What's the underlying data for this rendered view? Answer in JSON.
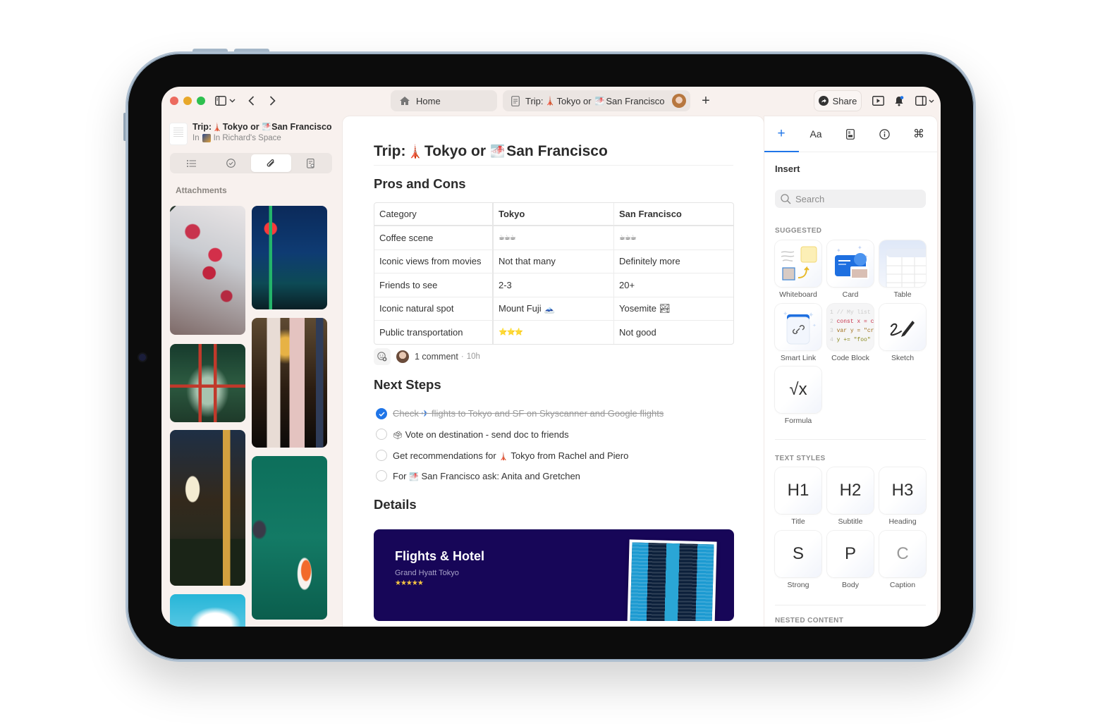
{
  "toolbar": {
    "sidebar_toggle_icon": "sidebar-icon",
    "back_icon": "chevron-left-icon",
    "forward_icon": "chevron-right-icon",
    "tabs": [
      {
        "label": "Home",
        "icon": "house-icon"
      },
      {
        "label_prefix": "Trip:",
        "label_mid": "Tokyo or",
        "label_end": "San Francisco",
        "icon": "document-icon"
      }
    ],
    "new_tab_label": "+",
    "share_label": "Share",
    "accent_color": "#1f75e8"
  },
  "sidebar": {
    "doc_title_prefix": "Trip:",
    "doc_title_mid": "Tokyo or",
    "doc_title_end": "San Francisco",
    "doc_sub_prefix": "In",
    "doc_sub_space": "In Richard's Space",
    "segments": [
      "outline",
      "tasks",
      "attachments",
      "search-document"
    ],
    "active_segment": "attachments",
    "attachments_label": "Attachments",
    "photos": [
      "Plum blossoms",
      "Marugen 24 neon street",
      "Torii gate forest path",
      "Wind chimes",
      "Izakaya at night",
      "Koi pond",
      "Blue sky"
    ]
  },
  "document": {
    "title_prefix": "Trip:",
    "title_mid": "Tokyo or",
    "title_end": "San Francisco",
    "pros_cons_heading": "Pros and Cons",
    "table": {
      "headers": [
        "Category",
        "Tokyo",
        "San Francisco"
      ],
      "rows": [
        [
          "Coffee scene",
          "☕☕☕",
          "☕☕☕"
        ],
        [
          "Iconic views from movies",
          "Not that many",
          "Definitely more"
        ],
        [
          "Friends to see",
          "2-3",
          "20+"
        ],
        [
          "Iconic natural spot",
          "Mount Fuji 🗻",
          "Yosemite 🏞"
        ],
        [
          "Public transportation",
          "⭐⭐⭐",
          "Not good"
        ]
      ]
    },
    "comments": {
      "count_label": "1 comment",
      "separator": "·",
      "time": "10h"
    },
    "next_steps_heading": "Next Steps",
    "todos": [
      {
        "emoji": "",
        "text_a": "Check",
        "emoji_mid": "✈",
        "text_b": "flights to Tokyo and SF on Skyscanner and Google flights",
        "done": true
      },
      {
        "emoji": "🗳",
        "text_a": "Vote on destination - send doc to friends",
        "emoji_mid": "",
        "text_b": "",
        "done": false
      },
      {
        "emoji": "",
        "text_a": "Get recommendations for",
        "emoji_mid": "🗼",
        "text_b": "Tokyo from Rachel and Piero",
        "done": false
      },
      {
        "emoji": "",
        "text_a": "For",
        "emoji_mid": "🌁",
        "text_b": "San Francisco ask: Anita and Gretchen",
        "done": false
      }
    ],
    "details_heading": "Details",
    "card": {
      "title": "Flights & Hotel",
      "subtitle": "Grand Hyatt Tokyo",
      "stars": "★★★★★",
      "rating": 5,
      "bg_color": "#170658"
    }
  },
  "right_panel": {
    "tabs": [
      {
        "label": "+",
        "name": "insert"
      },
      {
        "label": "Aa",
        "name": "format"
      },
      {
        "label": "▤",
        "name": "document-info"
      },
      {
        "label": "ⓘ",
        "name": "info"
      },
      {
        "label": "⌘",
        "name": "shortcuts"
      }
    ],
    "active_tab": "insert",
    "insert_label": "Insert",
    "search_placeholder": "Search",
    "suggested_label": "SUGGESTED",
    "suggested": [
      "Whiteboard",
      "Card",
      "Table",
      "Smart Link",
      "Code Block",
      "Sketch",
      "Formula"
    ],
    "code_lines": [
      "// My list",
      "const x = cr",
      "var y = \"cra",
      "y += \"foo\""
    ],
    "text_styles_label": "TEXT STYLES",
    "text_styles": [
      {
        "glyph": "H1",
        "label": "Title"
      },
      {
        "glyph": "H2",
        "label": "Subtitle"
      },
      {
        "glyph": "H3",
        "label": "Heading"
      },
      {
        "glyph": "S",
        "label": "Strong"
      },
      {
        "glyph": "P",
        "label": "Body"
      },
      {
        "glyph": "C",
        "label": "Caption"
      }
    ],
    "nested_content_label": "NESTED CONTENT"
  }
}
